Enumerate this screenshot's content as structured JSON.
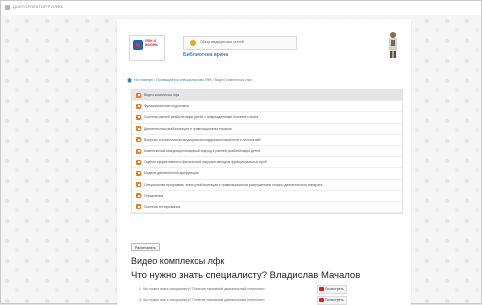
{
  "browser": {
    "url": "ДОКТОРЛЕКТОР.РУ/ЛФК"
  },
  "header": {
    "logo_text": "ЛФК И ЖИЗНЬ",
    "partner_text": "Обзор медицинских статей",
    "site_title": "Библиотека врача"
  },
  "breadcrumb": {
    "items": [
      "На главную",
      "Посвящается специалистам ЛФК",
      "Видео комплексы лфк"
    ]
  },
  "list": {
    "items": [
      "Видео комплексы лфк",
      "Функциональная подготовка",
      "Система ранней реабилитации детей с повреждениями головного мозга",
      "Двигательная реабилитация и гравитационная терапия",
      "Вопросы и комплексная медицинская поддержка пациентов с патологией",
      "Комплексный междисциплинарный подход в ранней реабилитации детей",
      "Оценка эффективности физической нагрузки методом функциональных проб",
      "Модели двигательной дисфункции",
      "Специальная программа: этапы реабилитации с гравитационным разгружением опорно-двигательного аппарата",
      "Упражнения",
      "Система тестирования"
    ]
  },
  "print_button": "Распечатать",
  "section_title": "Видео комплексы лфк",
  "question_title": "Что нужно знать специалисту? Владислав Мачалов",
  "questions": [
    {
      "text": "1. Что нужно знать специалисту? Понятие «активный двигательный стереотип»",
      "button": "Посмотреть"
    },
    {
      "text": "2. Что нужно знать специалисту? Понятие «активный двигательный стереотип»",
      "button": "Посмотреть"
    }
  ],
  "colors": {
    "accent": "#3b7fc4",
    "item_icon": "#f07a26",
    "video": "#e31c1c"
  }
}
